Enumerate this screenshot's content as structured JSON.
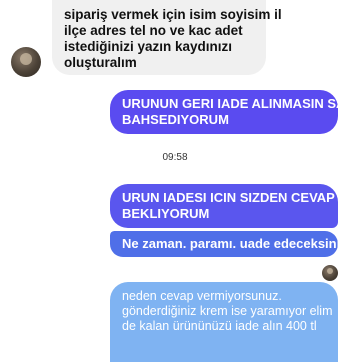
{
  "messages": {
    "incoming_1": {
      "lines": [
        "sipariş vermek için isim soyisim il",
        "ilçe adres tel no ve kac adet",
        "istediğinizi yazın kaydınızı",
        "oluşturalım"
      ]
    },
    "outgoing_1": {
      "lines": [
        "URUNUN GERI IADE ALINMASIN SAN",
        "BAHSEDIYORUM"
      ]
    },
    "timestamp": "09:58",
    "outgoing_2": {
      "lines": [
        "URUN IADESI ICIN SIZDEN CEVAP",
        "BEKLIYORUM"
      ]
    },
    "outgoing_3": {
      "lines": [
        "Ne zaman. paramı. uade edeceksiniz"
      ]
    },
    "outgoing_4": {
      "lines": [
        "neden cevap vermiyorsunuz.",
        "gönderdiğiniz krem ise yaramıyor elim",
        "de kalan  ürününüzü iade alın  400 tl"
      ]
    }
  },
  "colors": {
    "outgoing_purple": "#5a4bf0",
    "outgoing_blue": "#4f6fe8",
    "outgoing_light": "#7fb3f2",
    "incoming_bg": "#f0f0f0"
  }
}
